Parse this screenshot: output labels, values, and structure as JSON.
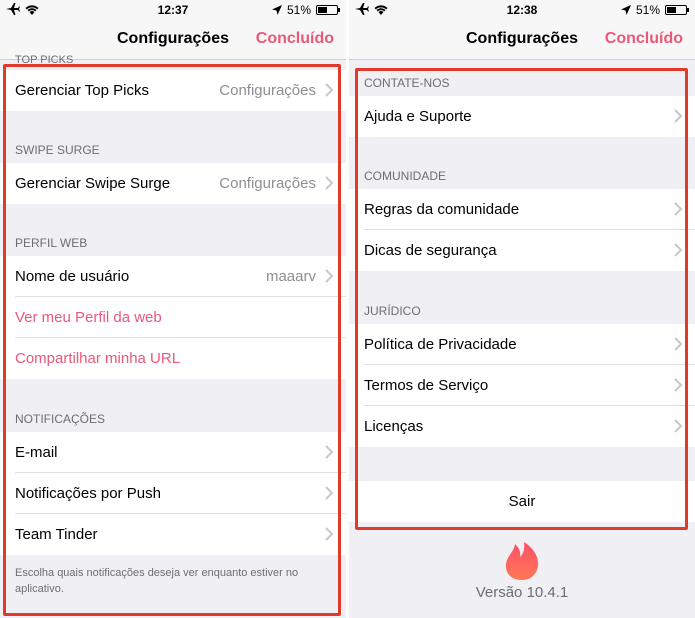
{
  "left": {
    "status": {
      "time": "12:37",
      "battery": "51%",
      "battery_level": 0.51
    },
    "nav": {
      "title": "Configurações",
      "done": "Concluído"
    },
    "truncated_header": "TOP PICKS",
    "top_picks": {
      "label": "Gerenciar Top Picks",
      "value": "Configurações"
    },
    "swipe_surge": {
      "header": "SWIPE SURGE",
      "label": "Gerenciar Swipe Surge",
      "value": "Configurações"
    },
    "perfil_web": {
      "header": "PERFIL WEB",
      "items": [
        {
          "label": "Nome de usuário",
          "value": "maaarv"
        },
        {
          "label": "Ver meu Perfil da web"
        },
        {
          "label": "Compartilhar minha URL"
        }
      ]
    },
    "notificacoes": {
      "header": "NOTIFICAÇÕES",
      "items": [
        {
          "label": "E-mail"
        },
        {
          "label": "Notificações por Push"
        },
        {
          "label": "Team Tinder"
        }
      ],
      "footer": "Escolha quais notificações deseja ver enquanto estiver no aplicativo."
    }
  },
  "right": {
    "status": {
      "time": "12:38",
      "battery": "51%",
      "battery_level": 0.51
    },
    "nav": {
      "title": "Configurações",
      "done": "Concluído"
    },
    "contate": {
      "header": "CONTATE-NOS",
      "items": [
        {
          "label": "Ajuda e Suporte"
        }
      ]
    },
    "comunidade": {
      "header": "COMUNIDADE",
      "items": [
        {
          "label": "Regras da comunidade"
        },
        {
          "label": "Dicas de segurança"
        }
      ]
    },
    "juridico": {
      "header": "JURÍDICO",
      "items": [
        {
          "label": "Política de Privacidade"
        },
        {
          "label": "Termos de Serviço"
        },
        {
          "label": "Licenças"
        }
      ]
    },
    "logout": "Sair",
    "version": "Versão 10.4.1"
  },
  "colors": {
    "accent": "#e8597a",
    "highlight": "#e03a2a",
    "background": "#efeff4"
  }
}
